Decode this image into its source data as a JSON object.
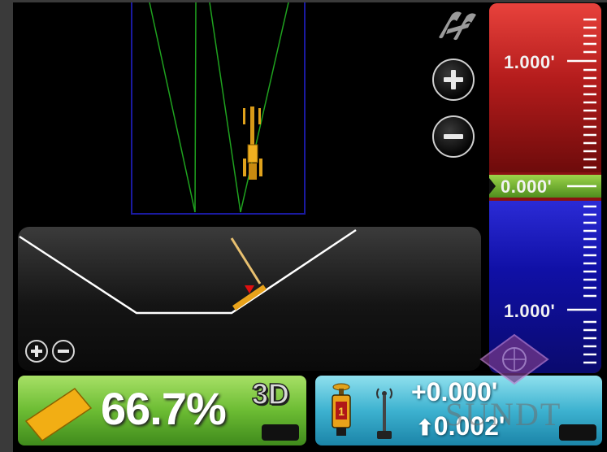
{
  "plan_view": {
    "zoom_in_icon": "plus-icon",
    "zoom_out_icon": "minus-icon",
    "view_toggle_icon": "view-mode-icon",
    "machine_icon": "grader-icon"
  },
  "cross_section": {
    "zoom_in_icon": "plus-icon",
    "zoom_out_icon": "minus-icon",
    "target_marker_color": "#e01010",
    "blade_color": "#e8a21a",
    "profile_color": "#ffffff"
  },
  "grade_scale": {
    "upper_label": "1.000'",
    "center_label": "0.000'",
    "lower_label": "1.000'",
    "colors": {
      "cut": "#d42a26",
      "on_grade": "#7cc23a",
      "fill": "#1c1cc4"
    }
  },
  "status_left": {
    "blade_icon": "blade-icon",
    "slope_value": "66.7%",
    "mode_badge": "3D"
  },
  "status_right": {
    "machine_icon": "mast-sensor-icon",
    "antenna_icon": "gps-antenna-icon",
    "elevation_offset": "+0.000'",
    "vertical_offset": "0.002'",
    "up_arrow": "⬆"
  },
  "watermark": {
    "text": "SUNDT",
    "logo_icon": "sundt-logo-icon"
  }
}
